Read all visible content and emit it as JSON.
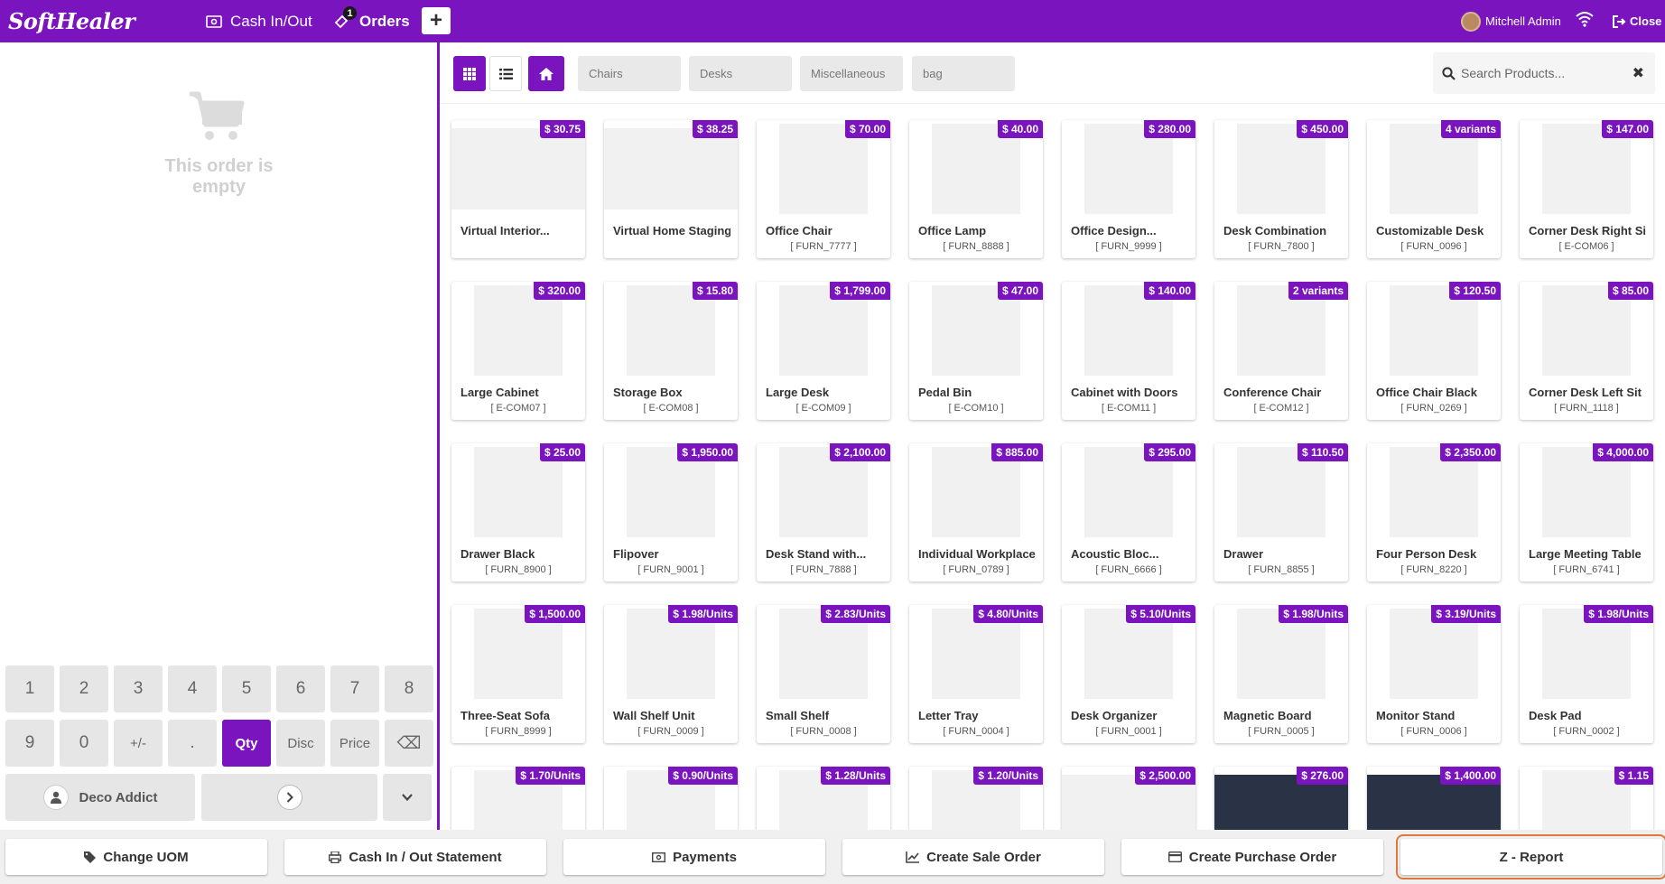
{
  "header": {
    "logo": "SoftHealer",
    "cash_in_out": "Cash In/Out",
    "orders_label": "Orders",
    "orders_badge": "1",
    "plus_label": "+",
    "user_name": "Mitchell Admin",
    "close_label": "Close",
    "bg_color": "#7a14be"
  },
  "order": {
    "empty_text": "This order is empty"
  },
  "numpad": {
    "row1": [
      "1",
      "2",
      "3",
      "4",
      "5",
      "6",
      "7",
      "8"
    ],
    "row2": [
      "9",
      "0",
      "+/-",
      ".",
      "Qty",
      "Disc",
      "Price",
      "⌫"
    ],
    "active_mode": "Qty",
    "customer": "Deco Addict"
  },
  "categories": [
    "Chairs",
    "Desks",
    "Miscellaneous",
    "bag"
  ],
  "search": {
    "placeholder": "Search Products..."
  },
  "products": [
    {
      "name": "Virtual Interior...",
      "ref": "",
      "price": "$ 30.75"
    },
    {
      "name": "Virtual Home Staging",
      "ref": "",
      "price": "$ 38.25"
    },
    {
      "name": "Office Chair",
      "ref": "[ FURN_7777 ]",
      "price": "$ 70.00"
    },
    {
      "name": "Office Lamp",
      "ref": "[ FURN_8888 ]",
      "price": "$ 40.00"
    },
    {
      "name": "Office Design...",
      "ref": "[ FURN_9999 ]",
      "price": "$ 280.00"
    },
    {
      "name": "Desk Combination",
      "ref": "[ FURN_7800 ]",
      "price": "$ 450.00"
    },
    {
      "name": "Customizable Desk",
      "ref": "[ FURN_0096 ]",
      "price": "4 variants"
    },
    {
      "name": "Corner Desk Right Sit",
      "ref": "[ E-COM06 ]",
      "price": "$ 147.00"
    },
    {
      "name": "Large Cabinet",
      "ref": "[ E-COM07 ]",
      "price": "$ 320.00"
    },
    {
      "name": "Storage Box",
      "ref": "[ E-COM08 ]",
      "price": "$ 15.80"
    },
    {
      "name": "Large Desk",
      "ref": "[ E-COM09 ]",
      "price": "$ 1,799.00"
    },
    {
      "name": "Pedal Bin",
      "ref": "[ E-COM10 ]",
      "price": "$ 47.00"
    },
    {
      "name": "Cabinet with Doors",
      "ref": "[ E-COM11 ]",
      "price": "$ 140.00"
    },
    {
      "name": "Conference Chair",
      "ref": "[ E-COM12 ]",
      "price": "2 variants"
    },
    {
      "name": "Office Chair Black",
      "ref": "[ FURN_0269 ]",
      "price": "$ 120.50"
    },
    {
      "name": "Corner Desk Left Sit",
      "ref": "[ FURN_1118 ]",
      "price": "$ 85.00"
    },
    {
      "name": "Drawer Black",
      "ref": "[ FURN_8900 ]",
      "price": "$ 25.00"
    },
    {
      "name": "Flipover",
      "ref": "[ FURN_9001 ]",
      "price": "$ 1,950.00"
    },
    {
      "name": "Desk Stand with...",
      "ref": "[ FURN_7888 ]",
      "price": "$ 2,100.00"
    },
    {
      "name": "Individual Workplace",
      "ref": "[ FURN_0789 ]",
      "price": "$ 885.00"
    },
    {
      "name": "Acoustic Bloc...",
      "ref": "[ FURN_6666 ]",
      "price": "$ 295.00"
    },
    {
      "name": "Drawer",
      "ref": "[ FURN_8855 ]",
      "price": "$ 110.50"
    },
    {
      "name": "Four Person Desk",
      "ref": "[ FURN_8220 ]",
      "price": "$ 2,350.00"
    },
    {
      "name": "Large Meeting Table",
      "ref": "[ FURN_6741 ]",
      "price": "$ 4,000.00"
    },
    {
      "name": "Three-Seat Sofa",
      "ref": "[ FURN_8999 ]",
      "price": "$ 1,500.00"
    },
    {
      "name": "Wall Shelf Unit",
      "ref": "[ FURN_0009 ]",
      "price": "$ 1.98/Units"
    },
    {
      "name": "Small Shelf",
      "ref": "[ FURN_0008 ]",
      "price": "$ 2.83/Units"
    },
    {
      "name": "Letter Tray",
      "ref": "[ FURN_0004 ]",
      "price": "$ 4.80/Units"
    },
    {
      "name": "Desk Organizer",
      "ref": "[ FURN_0001 ]",
      "price": "$ 5.10/Units"
    },
    {
      "name": "Magnetic Board",
      "ref": "[ FURN_0005 ]",
      "price": "$ 1.98/Units"
    },
    {
      "name": "Monitor Stand",
      "ref": "[ FURN_0006 ]",
      "price": "$ 3.19/Units"
    },
    {
      "name": "Desk Pad",
      "ref": "[ FURN_0002 ]",
      "price": "$ 1.98/Units"
    },
    {
      "name": "",
      "ref": "",
      "price": "$ 1.70/Units"
    },
    {
      "name": "",
      "ref": "",
      "price": "$ 0.90/Units"
    },
    {
      "name": "",
      "ref": "",
      "price": "$ 1.28/Units"
    },
    {
      "name": "",
      "ref": "",
      "price": "$ 1.20/Units"
    },
    {
      "name": "",
      "ref": "",
      "price": "$ 2,500.00"
    },
    {
      "name": "",
      "ref": "",
      "price": "$ 276.00"
    },
    {
      "name": "",
      "ref": "",
      "price": "$ 1,400.00"
    },
    {
      "name": "",
      "ref": "",
      "price": "$ 1.15"
    }
  ],
  "bottom_bar": [
    {
      "label": "Change UOM",
      "icon": "tag-icon"
    },
    {
      "label": "Cash In / Out Statement",
      "icon": "print-icon"
    },
    {
      "label": "Payments",
      "icon": "money-icon"
    },
    {
      "label": "Create Sale Order",
      "icon": "chart-icon"
    },
    {
      "label": "Create Purchase Order",
      "icon": "card-icon"
    },
    {
      "label": "Z - Report",
      "icon": ""
    }
  ]
}
